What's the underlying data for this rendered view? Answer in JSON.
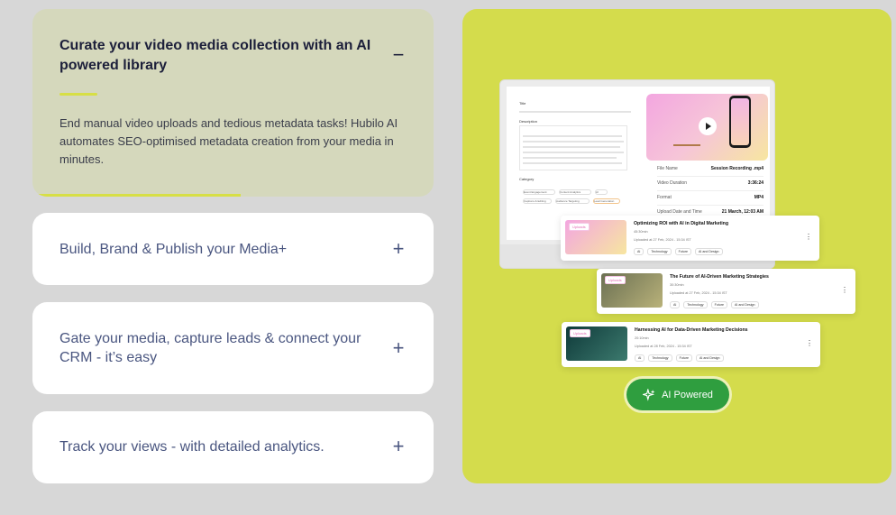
{
  "accordion": {
    "items": [
      {
        "title": "Curate your video media collection with an AI powered library",
        "toggle": "−",
        "body": "End manual video uploads and tedious metadata tasks! Hubilo AI automates SEO-optimised metadata creation from your media in minutes.",
        "progress": 0.52
      },
      {
        "title": "Build, Brand & Publish your Media+",
        "toggle": "+"
      },
      {
        "title": "Gate your media, capture leads & connect your CRM - it’s easy",
        "toggle": "+"
      },
      {
        "title": "Track your views - with detailed analytics.",
        "toggle": "+"
      }
    ]
  },
  "preview": {
    "form": {
      "title_label": "Title",
      "description_label": "Description",
      "category_label": "Category",
      "chips": [
        "Event Engagement",
        "Content Analytics",
        "AI",
        "Captions & Editing",
        "Audience Targeting",
        "Lead Generation"
      ]
    },
    "video": {
      "rows": [
        {
          "key": "File Name",
          "value": "Session Recording .mp4"
        },
        {
          "key": "Video Duration",
          "value": "3:36:24"
        },
        {
          "key": "Format",
          "value": "MP4"
        },
        {
          "key": "Upload Date and Time",
          "value": "21 March, 12:03 AM"
        }
      ]
    },
    "uploads": [
      {
        "badge": "Uploads",
        "title": "Optimizing ROI with AI in Digital Marketing",
        "duration": "45:30min",
        "uploaded": "Uploaded at 27 Feb, 2024 - 15:34 IST",
        "tags": [
          "AI",
          "Technology",
          "Future",
          "AI and Design"
        ]
      },
      {
        "badge": "Uploads",
        "title": "The Future of AI-Driven Marketing Strategies",
        "duration": "30:30min",
        "uploaded": "Uploaded at 27 Feb, 2024 - 15:34 IST",
        "tags": [
          "AI",
          "Technology",
          "Future",
          "AI and Design"
        ]
      },
      {
        "badge": "Uploads",
        "title": "Harnessing AI for Data-Driven Marketing Decisions",
        "duration": "20:10min",
        "uploaded": "Uploaded at 28 Feb, 2024 - 15:34 IST",
        "tags": [
          "AI",
          "Technology",
          "Future",
          "AI and Design"
        ]
      }
    ],
    "ai_button": "AI Powered"
  },
  "colors": {
    "page_bg": "#d7d7d7",
    "panel_bg": "#d4dc4c",
    "accent": "#d7df45",
    "button_green": "#2f9e3f"
  }
}
